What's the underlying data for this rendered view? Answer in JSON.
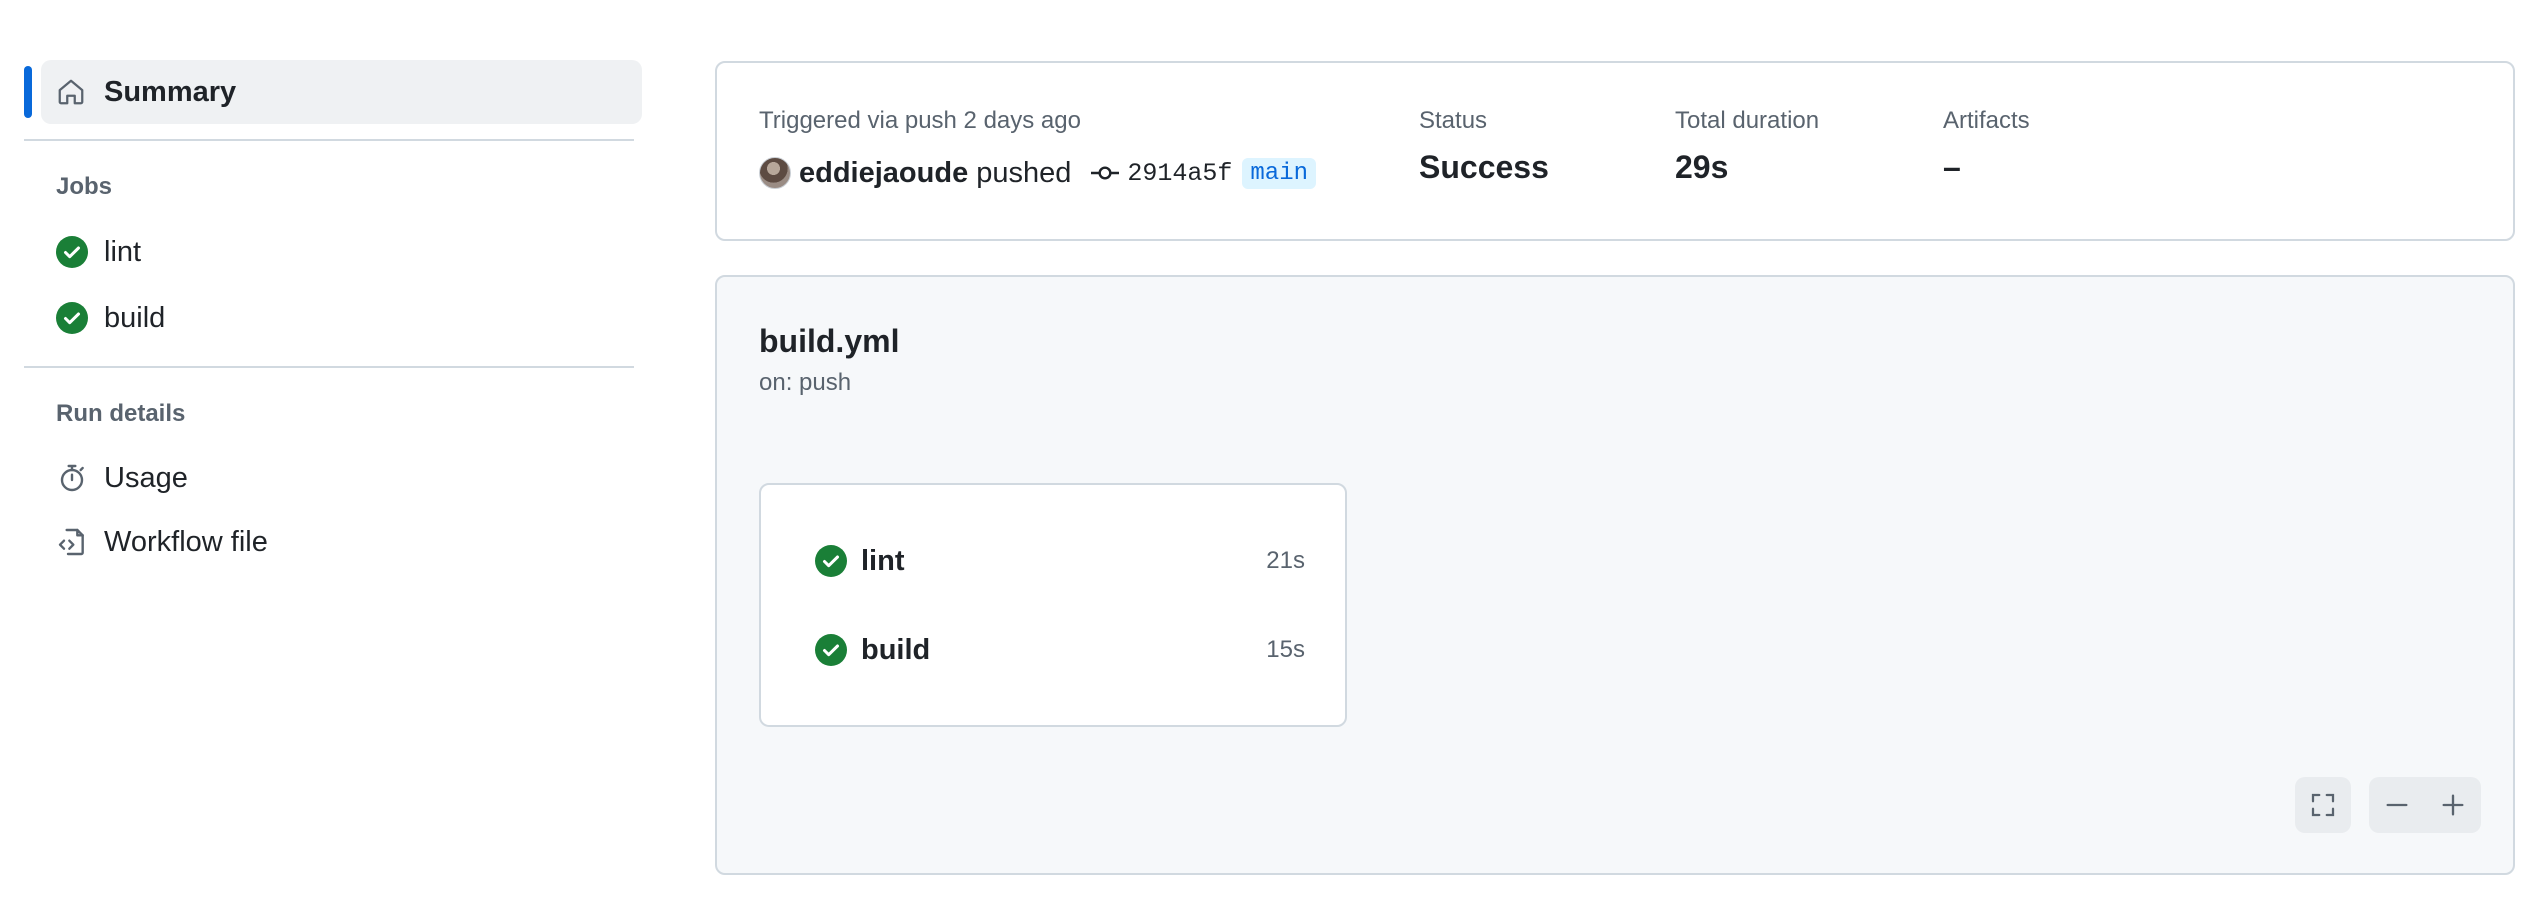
{
  "sidebar": {
    "summary_label": "Summary",
    "jobs_heading": "Jobs",
    "jobs": [
      {
        "label": "lint",
        "icon": "check-circle-icon"
      },
      {
        "label": "build",
        "icon": "check-circle-icon"
      }
    ],
    "run_details_heading": "Run details",
    "run_details": [
      {
        "label": "Usage",
        "icon": "stopwatch-icon"
      },
      {
        "label": "Workflow file",
        "icon": "file-code-icon"
      }
    ]
  },
  "run": {
    "trigger_text": "Triggered via push 2 days ago",
    "actor": "eddiejaoude",
    "action": "pushed",
    "commit_sha": "2914a5f",
    "branch": "main",
    "status_label": "Status",
    "status_value": "Success",
    "duration_label": "Total duration",
    "duration_value": "29s",
    "artifacts_label": "Artifacts",
    "artifacts_value": "–"
  },
  "workflow": {
    "file_name": "build.yml",
    "trigger": "on: push",
    "jobs": [
      {
        "name": "lint",
        "duration": "21s"
      },
      {
        "name": "build",
        "duration": "15s"
      }
    ]
  },
  "colors": {
    "accent": "#0969da",
    "success": "#1a7f37",
    "muted_text": "#59636e",
    "border": "#d1d9e0"
  }
}
